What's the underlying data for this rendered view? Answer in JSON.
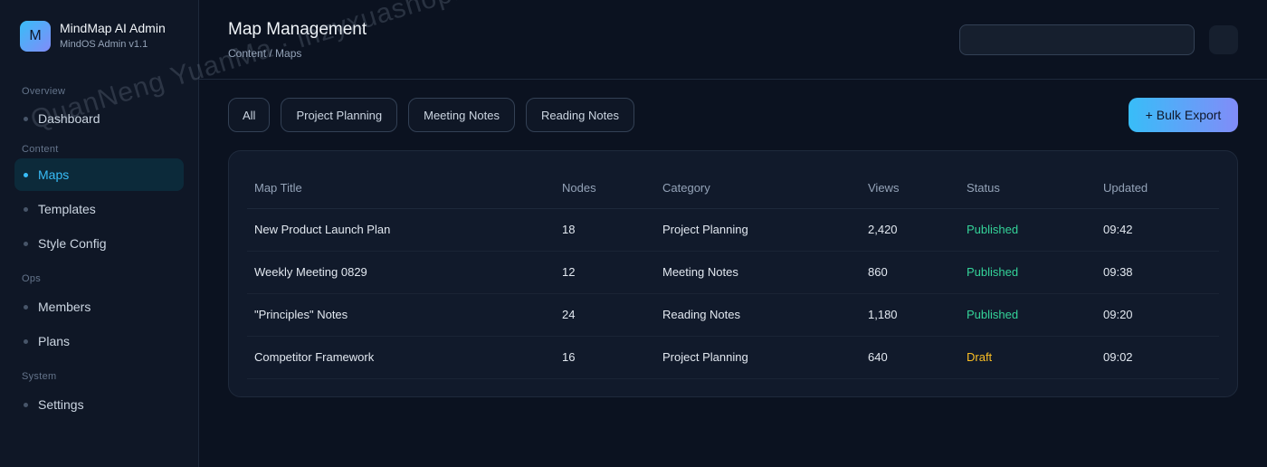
{
  "brand": {
    "logo_letter": "M",
    "name": "MindMap AI Admin",
    "subtitle": "MindOS Admin v1.1"
  },
  "sidebar": {
    "sections": [
      {
        "label": "Overview",
        "items": [
          {
            "label": "Dashboard",
            "active": false
          }
        ]
      },
      {
        "label": "Content",
        "items": [
          {
            "label": "Maps",
            "active": true
          },
          {
            "label": "Templates",
            "active": false
          },
          {
            "label": "Style Config",
            "active": false
          }
        ]
      },
      {
        "label": "Ops",
        "items": [
          {
            "label": "Members",
            "active": false
          },
          {
            "label": "Plans",
            "active": false
          }
        ]
      },
      {
        "label": "System",
        "items": [
          {
            "label": "Settings",
            "active": false
          }
        ]
      }
    ]
  },
  "header": {
    "title": "Map Management",
    "breadcrumb": "Content / Maps",
    "search_value": ""
  },
  "filters": [
    "All",
    "Project Planning",
    "Meeting Notes",
    "Reading Notes"
  ],
  "actions": {
    "bulk_export": "+ Bulk Export"
  },
  "table": {
    "columns": [
      "Map Title",
      "Nodes",
      "Category",
      "Views",
      "Status",
      "Updated"
    ],
    "rows": [
      [
        "New Product Launch Plan",
        "18",
        "Project Planning",
        "2,420",
        "Published",
        "09:42"
      ],
      [
        "Weekly Meeting 0829",
        "12",
        "Meeting Notes",
        "860",
        "Published",
        "09:38"
      ],
      [
        "\"Principles\" Notes",
        "24",
        "Reading Notes",
        "1,180",
        "Published",
        "09:20"
      ],
      [
        "Competitor Framework",
        "16",
        "Project Planning",
        "640",
        "Draft",
        "09:02"
      ]
    ]
  },
  "watermark": "QuanNeng YuanMa · inzyxuashop.com",
  "colors": {
    "background": "#0b1220",
    "accent": "#38bdf8",
    "accent_secondary": "#818cf8",
    "status_published": "#34d399",
    "status_draft": "#fbbf24"
  }
}
